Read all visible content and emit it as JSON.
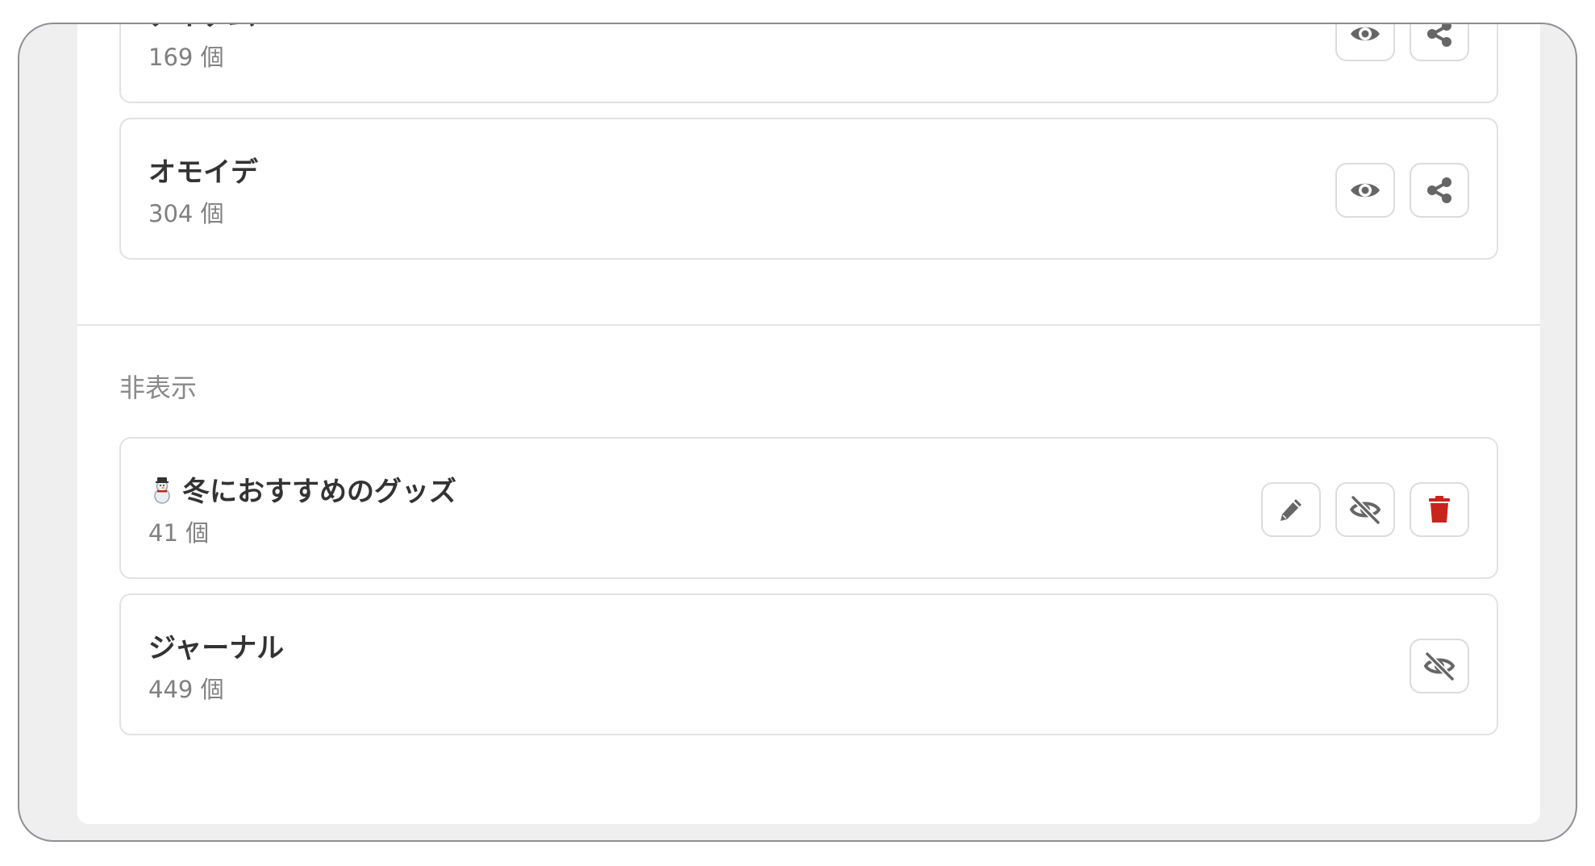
{
  "colors": {
    "icon_gray": "#666666",
    "danger_red": "#c8231c",
    "title_text": "#333333",
    "muted_text": "#808080"
  },
  "visible_cards": [
    {
      "title": "アイテム",
      "count": "169 個",
      "actions": [
        "eye-icon",
        "share-icon"
      ]
    },
    {
      "title": "オモイデ",
      "count": "304 個",
      "actions": [
        "eye-icon",
        "share-icon"
      ]
    }
  ],
  "hidden_section": {
    "heading": "非表示",
    "cards": [
      {
        "emoji": "snowman-icon",
        "title": "冬におすすめのグッズ",
        "count": "41 個",
        "actions": [
          "pencil-icon",
          "eye-slash-icon",
          "trash-icon"
        ]
      },
      {
        "title": "ジャーナル",
        "count": "449 個",
        "actions": [
          "eye-slash-icon"
        ]
      }
    ]
  }
}
